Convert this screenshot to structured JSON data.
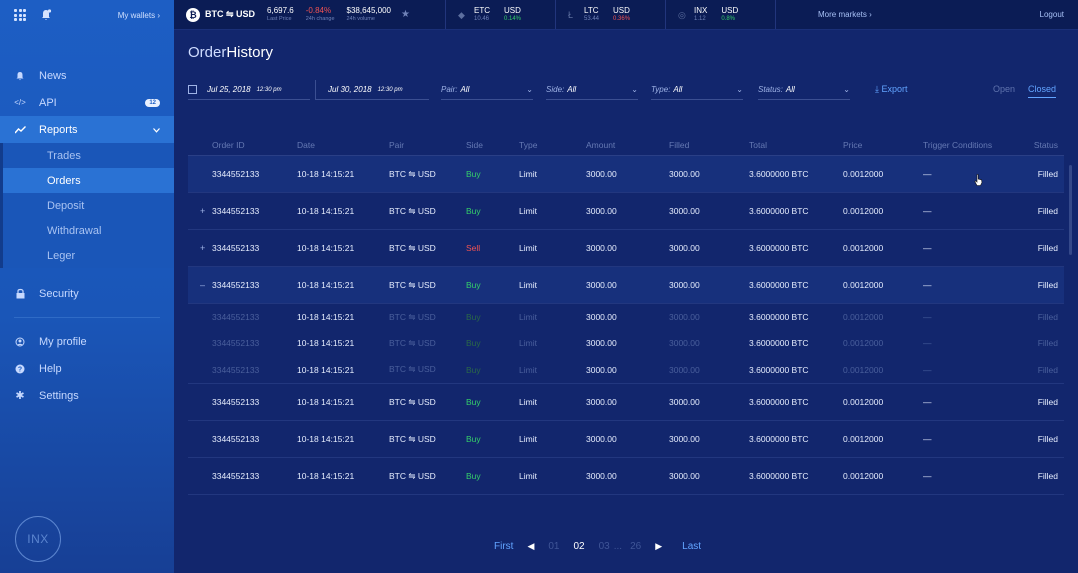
{
  "sidebar": {
    "wallets_link": "My wallets ›",
    "items": [
      {
        "label": "News",
        "icon": "bell-icon"
      },
      {
        "label": "API",
        "icon": "code-icon",
        "badge": "12"
      },
      {
        "label": "Reports",
        "icon": "chart-icon"
      }
    ],
    "sub_items": [
      "Trades",
      "Orders",
      "Deposit",
      "Withdrawal",
      "Leger"
    ],
    "lower_items": [
      {
        "label": "Security",
        "icon": "lock-icon"
      },
      {
        "label": "My profile",
        "icon": "profile-icon"
      },
      {
        "label": "Help",
        "icon": "help-icon"
      },
      {
        "label": "Settings",
        "icon": "gear-icon"
      }
    ],
    "logo": "INX"
  },
  "ticker": {
    "main_pair": "BTC ⇋ USD",
    "last_price": "6,697.6",
    "last_price_label": "Last Price",
    "change": "-0.84%",
    "change_label": "24h change",
    "volume": "$38,645,000",
    "volume_label": "24h volume",
    "markets": [
      {
        "base": "ETC",
        "base_val": "10.46",
        "quote": "USD",
        "quote_val": "0.14%",
        "dir": "up"
      },
      {
        "base": "LTC",
        "base_val": "53.44",
        "quote": "USD",
        "quote_val": "0.36%",
        "dir": "down"
      },
      {
        "base": "INX",
        "base_val": "1.12",
        "quote": "USD",
        "quote_val": "0.8%",
        "dir": "up"
      }
    ],
    "more_markets": "More markets ›",
    "logout": "Logout"
  },
  "page": {
    "title_light": "Order",
    "title_bold": "History"
  },
  "filters": {
    "date_from": "Jul 25, 2018",
    "time_from": "12:30 pm",
    "date_to": "Jul 30, 2018",
    "time_to": "12:30 pm",
    "pair_label": "Pair:",
    "pair_value": "All",
    "side_label": "Side:",
    "side_value": "All",
    "type_label": "Type:",
    "type_value": "All",
    "status_label": "Status:",
    "status_value": "All",
    "export": "Export",
    "tab_open": "Open",
    "tab_closed": "Closed"
  },
  "table": {
    "headers": [
      "Order ID",
      "Date",
      "Pair",
      "Side",
      "Type",
      "Amount",
      "Filled",
      "Total",
      "Price",
      "Trigger Conditions",
      "Status"
    ],
    "rows": [
      {
        "id": "3344552133",
        "date": "10-18 14:15:21",
        "pair": "BTC ⇋ USD",
        "side": "Buy",
        "type": "Limit",
        "amount": "3000.00",
        "filled": "3000.00",
        "total": "3.6000000 BTC",
        "price": "0.0012000",
        "trigger": "—",
        "status": "Filled"
      },
      {
        "id": "3344552133",
        "date": "10-18 14:15:21",
        "pair": "BTC ⇋ USD",
        "side": "Buy",
        "type": "Limit",
        "amount": "3000.00",
        "filled": "3000.00",
        "total": "3.6000000 BTC",
        "price": "0.0012000",
        "trigger": "—",
        "status": "Filled"
      },
      {
        "id": "3344552133",
        "date": "10-18 14:15:21",
        "pair": "BTC ⇋ USD",
        "side": "Sell",
        "type": "Limit",
        "amount": "3000.00",
        "filled": "3000.00",
        "total": "3.6000000 BTC",
        "price": "0.0012000",
        "trigger": "—",
        "status": "Filled"
      },
      {
        "id": "3344552133",
        "date": "10-18 14:15:21",
        "pair": "BTC ⇋ USD",
        "side": "Buy",
        "type": "Limit",
        "amount": "3000.00",
        "filled": "3000.00",
        "total": "3.6000000 BTC",
        "price": "0.0012000",
        "trigger": "—",
        "status": "Filled"
      },
      {
        "id": "3344552133",
        "date": "10-18 14:15:21",
        "pair": "BTC ⇋ USD",
        "side": "Buy",
        "type": "Limit",
        "amount": "3000.00",
        "filled": "3000.00",
        "total": "3.6000000 BTC",
        "price": "0.0012000",
        "trigger": "—",
        "status": "Filled"
      },
      {
        "id": "3344552133",
        "date": "10-18 14:15:21",
        "pair": "BTC ⇋ USD",
        "side": "Buy",
        "type": "Limit",
        "amount": "3000.00",
        "filled": "3000.00",
        "total": "3.6000000 BTC",
        "price": "0.0012000",
        "trigger": "—",
        "status": "Filled"
      },
      {
        "id": "3344552133",
        "date": "10-18 14:15:21",
        "pair": "BTC ⇋ USD",
        "side": "Buy",
        "type": "Limit",
        "amount": "3000.00",
        "filled": "3000.00",
        "total": "3.6000000 BTC",
        "price": "0.0012000",
        "trigger": "—",
        "status": "Filled"
      }
    ],
    "sub_rows": [
      {
        "id": "3344552133",
        "date": "10-18 14:15:21",
        "pair": "BTC ⇋ USD",
        "side": "Buy",
        "type": "Limit",
        "amount": "3000.00",
        "filled": "3000.00",
        "total": "3.6000000 BTC",
        "price": "0.0012000",
        "trigger": "—",
        "status": "Filled"
      },
      {
        "id": "3344552133",
        "date": "10-18 14:15:21",
        "pair": "BTC ⇋ USD",
        "side": "Buy",
        "type": "Limit",
        "amount": "3000.00",
        "filled": "3000.00",
        "total": "3.6000000 BTC",
        "price": "0.0012000",
        "trigger": "—",
        "status": "Filled"
      },
      {
        "id": "3344552133",
        "date": "10-18 14:15:21",
        "pair": "BTC ⇋ USD",
        "side": "Buy",
        "type": "Limit",
        "amount": "3000.00",
        "filled": "3000.00",
        "total": "3.6000000 BTC",
        "price": "0.0012000",
        "trigger": "—",
        "status": "Filled"
      }
    ],
    "expand_plus": "+",
    "expand_minus": "–"
  },
  "pagination": {
    "first": "First",
    "pages": [
      "01",
      "02",
      "03",
      "...",
      "26"
    ],
    "current": "02",
    "last": "Last"
  },
  "colors": {
    "accent": "#62a4ff",
    "buy": "#35d06a",
    "sell": "#f15353",
    "sidebar": "#1d5ec4",
    "background": "#12266d"
  }
}
